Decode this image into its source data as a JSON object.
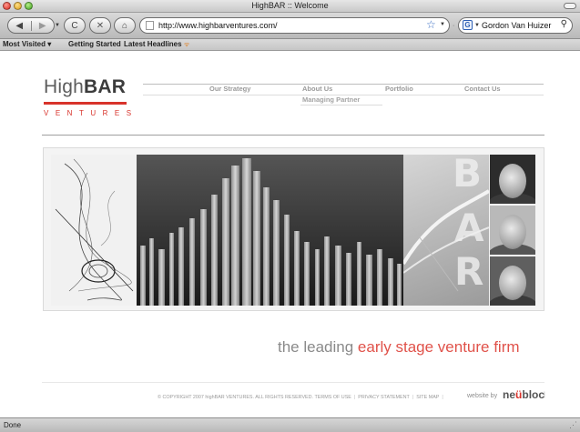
{
  "window": {
    "title": "HighBAR :: Welcome"
  },
  "toolbar": {
    "back": "◀",
    "forward": "▶",
    "reload": "C",
    "stop": "✕",
    "home": "⌂",
    "url": "http://www.highbarventures.com/",
    "search_value": "Gordon Van Huizer",
    "search_engine": "G"
  },
  "bookmarks": {
    "items": [
      "Most Visited ▾",
      "Getting Started",
      "Latest Headlines"
    ]
  },
  "logo": {
    "word_light": "High",
    "word_bold": "BAR",
    "sub": "VENTURES",
    "accent": "#d8332b"
  },
  "nav": {
    "items": [
      "Our Strategy",
      "About Us",
      "Portfolio",
      "Contact Us"
    ],
    "about_sub": [
      "Managing Partner"
    ]
  },
  "banner": {
    "letters": [
      "B",
      "A",
      "R"
    ]
  },
  "tagline": {
    "part1": "the leading ",
    "part2": "early stage venture firm"
  },
  "footer": {
    "copyright": "© COPYRIGHT 2007 highBAR VENTURES. ALL RIGHTS RESERVED.",
    "terms": "TERMS OF USE",
    "privacy": "PRIVACY STATEMENT",
    "sitemap": "SITE MAP",
    "credit_prefix": "website by",
    "credit_brand_1": "ne",
    "credit_brand_2": "ü",
    "credit_brand_3": "bloc"
  },
  "status": {
    "text": "Done"
  },
  "colors": {
    "accent_red": "#d8332b",
    "tagline_red": "#e0524a",
    "nav_gray": "#9a9a9a"
  }
}
